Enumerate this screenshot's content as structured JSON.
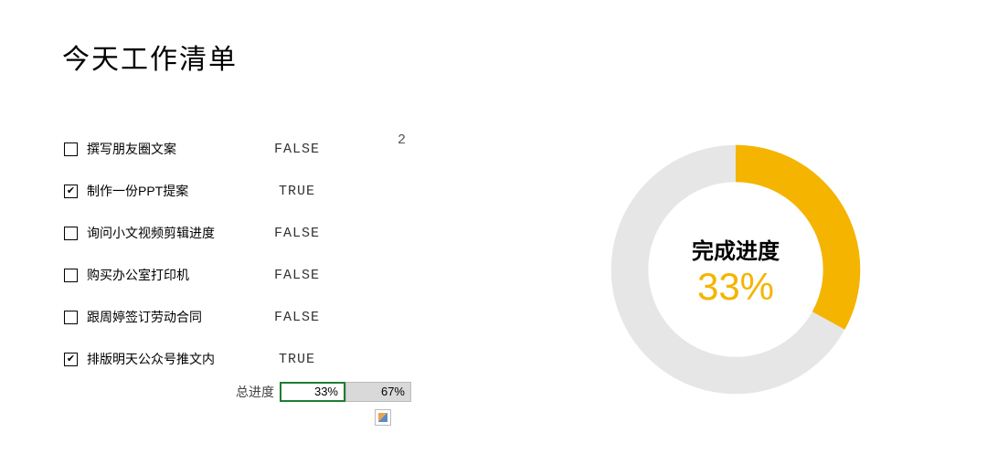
{
  "title": "今天工作清单",
  "tasks": [
    {
      "label": "撰写朋友圈文案",
      "checked": false,
      "status": "FALSE"
    },
    {
      "label": "制作一份PPT提案",
      "checked": true,
      "status": "TRUE"
    },
    {
      "label": "询问小文视频剪辑进度",
      "checked": false,
      "status": "FALSE"
    },
    {
      "label": "购买办公室打印机",
      "checked": false,
      "status": "FALSE"
    },
    {
      "label": "跟周婷签订劳动合同",
      "checked": false,
      "status": "FALSE"
    },
    {
      "label": "排版明天公众号推文内",
      "checked": true,
      "status": "TRUE"
    }
  ],
  "extra_number": "2",
  "summary": {
    "label": "总进度",
    "done_pct": "33%",
    "remain_pct": "67%"
  },
  "chart_data": {
    "type": "pie",
    "title": "完成进度",
    "center_value": "33%",
    "series": [
      {
        "name": "done",
        "value": 33,
        "color": "#f5b400"
      },
      {
        "name": "remain",
        "value": 67,
        "color": "#e6e6e6"
      }
    ],
    "donut_hole": true
  },
  "colors": {
    "accent": "#f5b400",
    "ring_bg": "#e6e6e6",
    "cell_border": "#1e7e34"
  }
}
